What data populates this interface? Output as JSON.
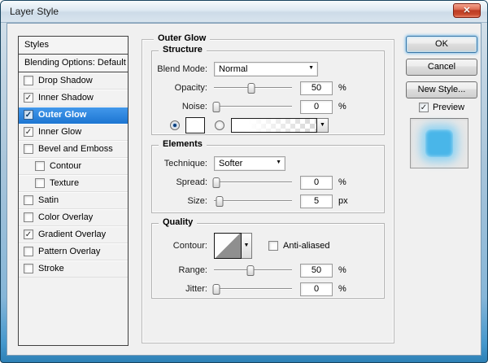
{
  "window": {
    "title": "Layer Style"
  },
  "icons": {
    "close": "✕",
    "checkmark": "✓",
    "dropdown_arrow": "▼"
  },
  "colors": {
    "selection_blue": "#2b87e3",
    "close_red": "#c8492d",
    "glow_blue": "#49b6e9",
    "dialog_bg": "#f0f0f0"
  },
  "sidebar": {
    "header": "Styles",
    "blending": "Blending Options: Default",
    "items": [
      {
        "label": "Drop Shadow",
        "checked": false,
        "selected": false,
        "indent": false
      },
      {
        "label": "Inner Shadow",
        "checked": true,
        "selected": false,
        "indent": false
      },
      {
        "label": "Outer Glow",
        "checked": true,
        "selected": true,
        "indent": false
      },
      {
        "label": "Inner Glow",
        "checked": true,
        "selected": false,
        "indent": false
      },
      {
        "label": "Bevel and Emboss",
        "checked": false,
        "selected": false,
        "indent": false
      },
      {
        "label": "Contour",
        "checked": false,
        "selected": false,
        "indent": true
      },
      {
        "label": "Texture",
        "checked": false,
        "selected": false,
        "indent": true
      },
      {
        "label": "Satin",
        "checked": false,
        "selected": false,
        "indent": false
      },
      {
        "label": "Color Overlay",
        "checked": false,
        "selected": false,
        "indent": false
      },
      {
        "label": "Gradient Overlay",
        "checked": true,
        "selected": false,
        "indent": false
      },
      {
        "label": "Pattern Overlay",
        "checked": false,
        "selected": false,
        "indent": false
      },
      {
        "label": "Stroke",
        "checked": false,
        "selected": false,
        "indent": false
      }
    ]
  },
  "panel": {
    "title": "Outer Glow",
    "structure": {
      "title": "Structure",
      "blend_mode_label": "Blend Mode:",
      "blend_mode_value": "Normal",
      "opacity_label": "Opacity:",
      "opacity_value": "50",
      "opacity_unit": "%",
      "opacity_pct": 48,
      "noise_label": "Noise:",
      "noise_value": "0",
      "noise_unit": "%",
      "noise_pct": 3
    },
    "elements": {
      "title": "Elements",
      "technique_label": "Technique:",
      "technique_value": "Softer",
      "spread_label": "Spread:",
      "spread_value": "0",
      "spread_unit": "%",
      "spread_pct": 3,
      "size_label": "Size:",
      "size_value": "5",
      "size_unit": "px",
      "size_pct": 7
    },
    "quality": {
      "title": "Quality",
      "contour_label": "Contour:",
      "antialiased_label": "Anti-aliased",
      "antialiased_checked": false,
      "range_label": "Range:",
      "range_value": "50",
      "range_unit": "%",
      "range_pct": 47,
      "jitter_label": "Jitter:",
      "jitter_value": "0",
      "jitter_unit": "%",
      "jitter_pct": 3
    }
  },
  "actions": {
    "ok": "OK",
    "cancel": "Cancel",
    "new_style": "New Style...",
    "preview": "Preview",
    "preview_checked": true
  }
}
